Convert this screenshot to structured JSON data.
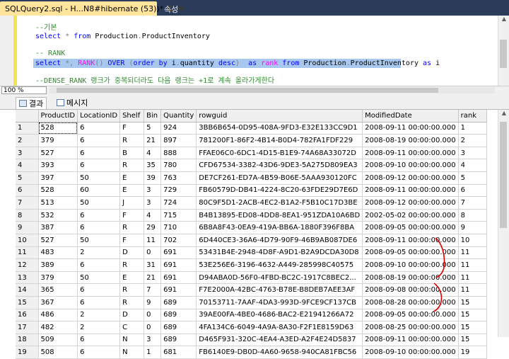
{
  "tabs": [
    {
      "label": "SQLQuery2.sql - H...N8#hibernate (53))*",
      "pin": "⊑",
      "close": "✕"
    },
    {
      "label": "속성"
    }
  ],
  "editor": {
    "lines": [
      {
        "parts": [
          {
            "t": "--기본",
            "c": "cmt"
          }
        ]
      },
      {
        "parts": [
          {
            "t": "select ",
            "c": "kw"
          },
          {
            "t": "* ",
            "c": "gr"
          },
          {
            "t": "from ",
            "c": "kw"
          },
          {
            "t": "Production",
            "c": ""
          },
          {
            "t": ".",
            "c": "gr"
          },
          {
            "t": "ProductInventory",
            "c": ""
          }
        ]
      },
      {
        "parts": []
      },
      {
        "parts": [
          {
            "t": "-- RANK",
            "c": "cmt"
          }
        ]
      },
      {
        "parts": [
          {
            "t": "select ",
            "c": "kw"
          },
          {
            "t": "*, ",
            "c": "gr"
          },
          {
            "t": "RANK",
            "c": "fn"
          },
          {
            "t": "() ",
            "c": "gr"
          },
          {
            "t": "OVER ",
            "c": "kw"
          },
          {
            "t": "(",
            "c": "gr"
          },
          {
            "t": "order by ",
            "c": "kw"
          },
          {
            "t": "i",
            "c": ""
          },
          {
            "t": ".",
            "c": "gr"
          },
          {
            "t": "quantity ",
            "c": ""
          },
          {
            "t": "desc",
            "c": "kw"
          },
          {
            "t": ")  ",
            "c": "gr"
          },
          {
            "t": "as ",
            "c": "kw"
          },
          {
            "t": "rank ",
            "c": "fn"
          },
          {
            "t": "from ",
            "c": "kw"
          },
          {
            "t": "Production",
            "c": ""
          },
          {
            "t": ".",
            "c": "gr"
          },
          {
            "t": "ProductInventory ",
            "c": ""
          },
          {
            "t": "as ",
            "c": "kw"
          },
          {
            "t": "i",
            "c": ""
          }
        ]
      },
      {
        "parts": []
      },
      {
        "parts": [
          {
            "t": "--DENSE_RANK 랭크가 중복되더라도 다음 랭크는 +1로 계속 올라가게한다",
            "c": "cmt"
          }
        ]
      }
    ]
  },
  "zoom": "100 %",
  "result_tabs": {
    "results": "결과",
    "messages": "메시지"
  },
  "grid": {
    "columns": [
      "",
      "ProductID",
      "LocationID",
      "Shelf",
      "Bin",
      "Quantity",
      "rowguid",
      "ModifiedDate",
      "rank"
    ],
    "rows": [
      [
        "1",
        "528",
        "6",
        "F",
        "5",
        "924",
        "3BB6B654-0D95-408A-9FD3-E32E133CC9D1",
        "2008-09-11 00:00:00.000",
        "1"
      ],
      [
        "2",
        "379",
        "6",
        "R",
        "21",
        "897",
        "781200F1-86F2-4B14-B0D4-782FA1FDF229",
        "2008-08-19 00:00:00.000",
        "2"
      ],
      [
        "3",
        "527",
        "6",
        "B",
        "4",
        "888",
        "FFAE06C0-6DC1-4D15-B1E9-74A68A33072D",
        "2008-09-11 00:00:00.000",
        "3"
      ],
      [
        "4",
        "393",
        "6",
        "R",
        "35",
        "780",
        "CFD67534-3382-43D6-9DE3-5A275D809EA3",
        "2008-09-10 00:00:00.000",
        "4"
      ],
      [
        "5",
        "397",
        "50",
        "E",
        "39",
        "763",
        "DE7CF261-ED7A-4B59-B06E-5AAA930120FC",
        "2008-09-12 00:00:00.000",
        "5"
      ],
      [
        "6",
        "528",
        "60",
        "E",
        "3",
        "729",
        "FB60579D-DB41-4224-8C20-63FDE29D7E6D",
        "2008-09-11 00:00:00.000",
        "6"
      ],
      [
        "7",
        "513",
        "50",
        "J",
        "3",
        "724",
        "80C9F5D1-2ACB-4EC2-B1A2-F5B10C17D3BE",
        "2008-09-12 00:00:00.000",
        "7"
      ],
      [
        "8",
        "532",
        "6",
        "F",
        "4",
        "715",
        "B4B13895-ED08-4DD8-8EA1-951ZDA10A6BD",
        "2002-05-02 00:00:00.000",
        "8"
      ],
      [
        "9",
        "387",
        "6",
        "R",
        "29",
        "710",
        "6B8A8F43-0EA9-419A-BB6A-1880F396F8BA",
        "2008-09-05 00:00:00.000",
        "9"
      ],
      [
        "10",
        "527",
        "50",
        "F",
        "11",
        "702",
        "6D440CE3-36A6-4D79-90F9-46B9AB087DE6",
        "2008-09-11 00:00:00.000",
        "10"
      ],
      [
        "11",
        "483",
        "2",
        "D",
        "0",
        "691",
        "53431B4E-2948-4D8F-A9D1-B2A9DCDA30D8",
        "2008-09-05 00:00:00.000",
        "11"
      ],
      [
        "12",
        "389",
        "6",
        "R",
        "31",
        "691",
        "53E256E6-3196-4632-A449-285998C40575",
        "2008-09-10 00:00:00.000",
        "11"
      ],
      [
        "13",
        "379",
        "50",
        "E",
        "21",
        "691",
        "D94ABA0D-56F0-4FBD-BC2C-1917C8BEC2...",
        "2008-08-19 00:00:00.000",
        "11"
      ],
      [
        "14",
        "365",
        "6",
        "R",
        "7",
        "691",
        "F7E2000A-42BC-4763-B78E-B8DEB7AEE3AF",
        "2008-09-08 00:00:00.000",
        "11"
      ],
      [
        "15",
        "367",
        "6",
        "R",
        "9",
        "689",
        "70153711-7AAF-4DA3-993D-9FCE9CF137CB",
        "2008-08-28 00:00:00.000",
        "15"
      ],
      [
        "16",
        "486",
        "2",
        "D",
        "0",
        "689",
        "39AE00FA-4BE0-4686-BAC2-E21941266A72",
        "2008-09-05 00:00:00.000",
        "15"
      ],
      [
        "17",
        "482",
        "2",
        "C",
        "0",
        "689",
        "4FA134C6-6049-4A9A-8A30-F2F1E8159D63",
        "2008-08-25 00:00:00.000",
        "15"
      ],
      [
        "18",
        "509",
        "6",
        "N",
        "3",
        "689",
        "D465F931-320C-4EA4-A3ED-A2F4E24D5837",
        "2008-09-11 00:00:00.000",
        "15"
      ],
      [
        "19",
        "508",
        "6",
        "N",
        "1",
        "681",
        "FB6140E9-DB0D-4A60-9658-940CA81FBC56",
        "2008-09-10 00:00:00.000",
        "19"
      ]
    ]
  },
  "colors": {
    "tab_active": "#ffe59c",
    "tabbar": "#2b3b5a",
    "selection": "#a8c8f0",
    "annotation": "#e00000"
  }
}
